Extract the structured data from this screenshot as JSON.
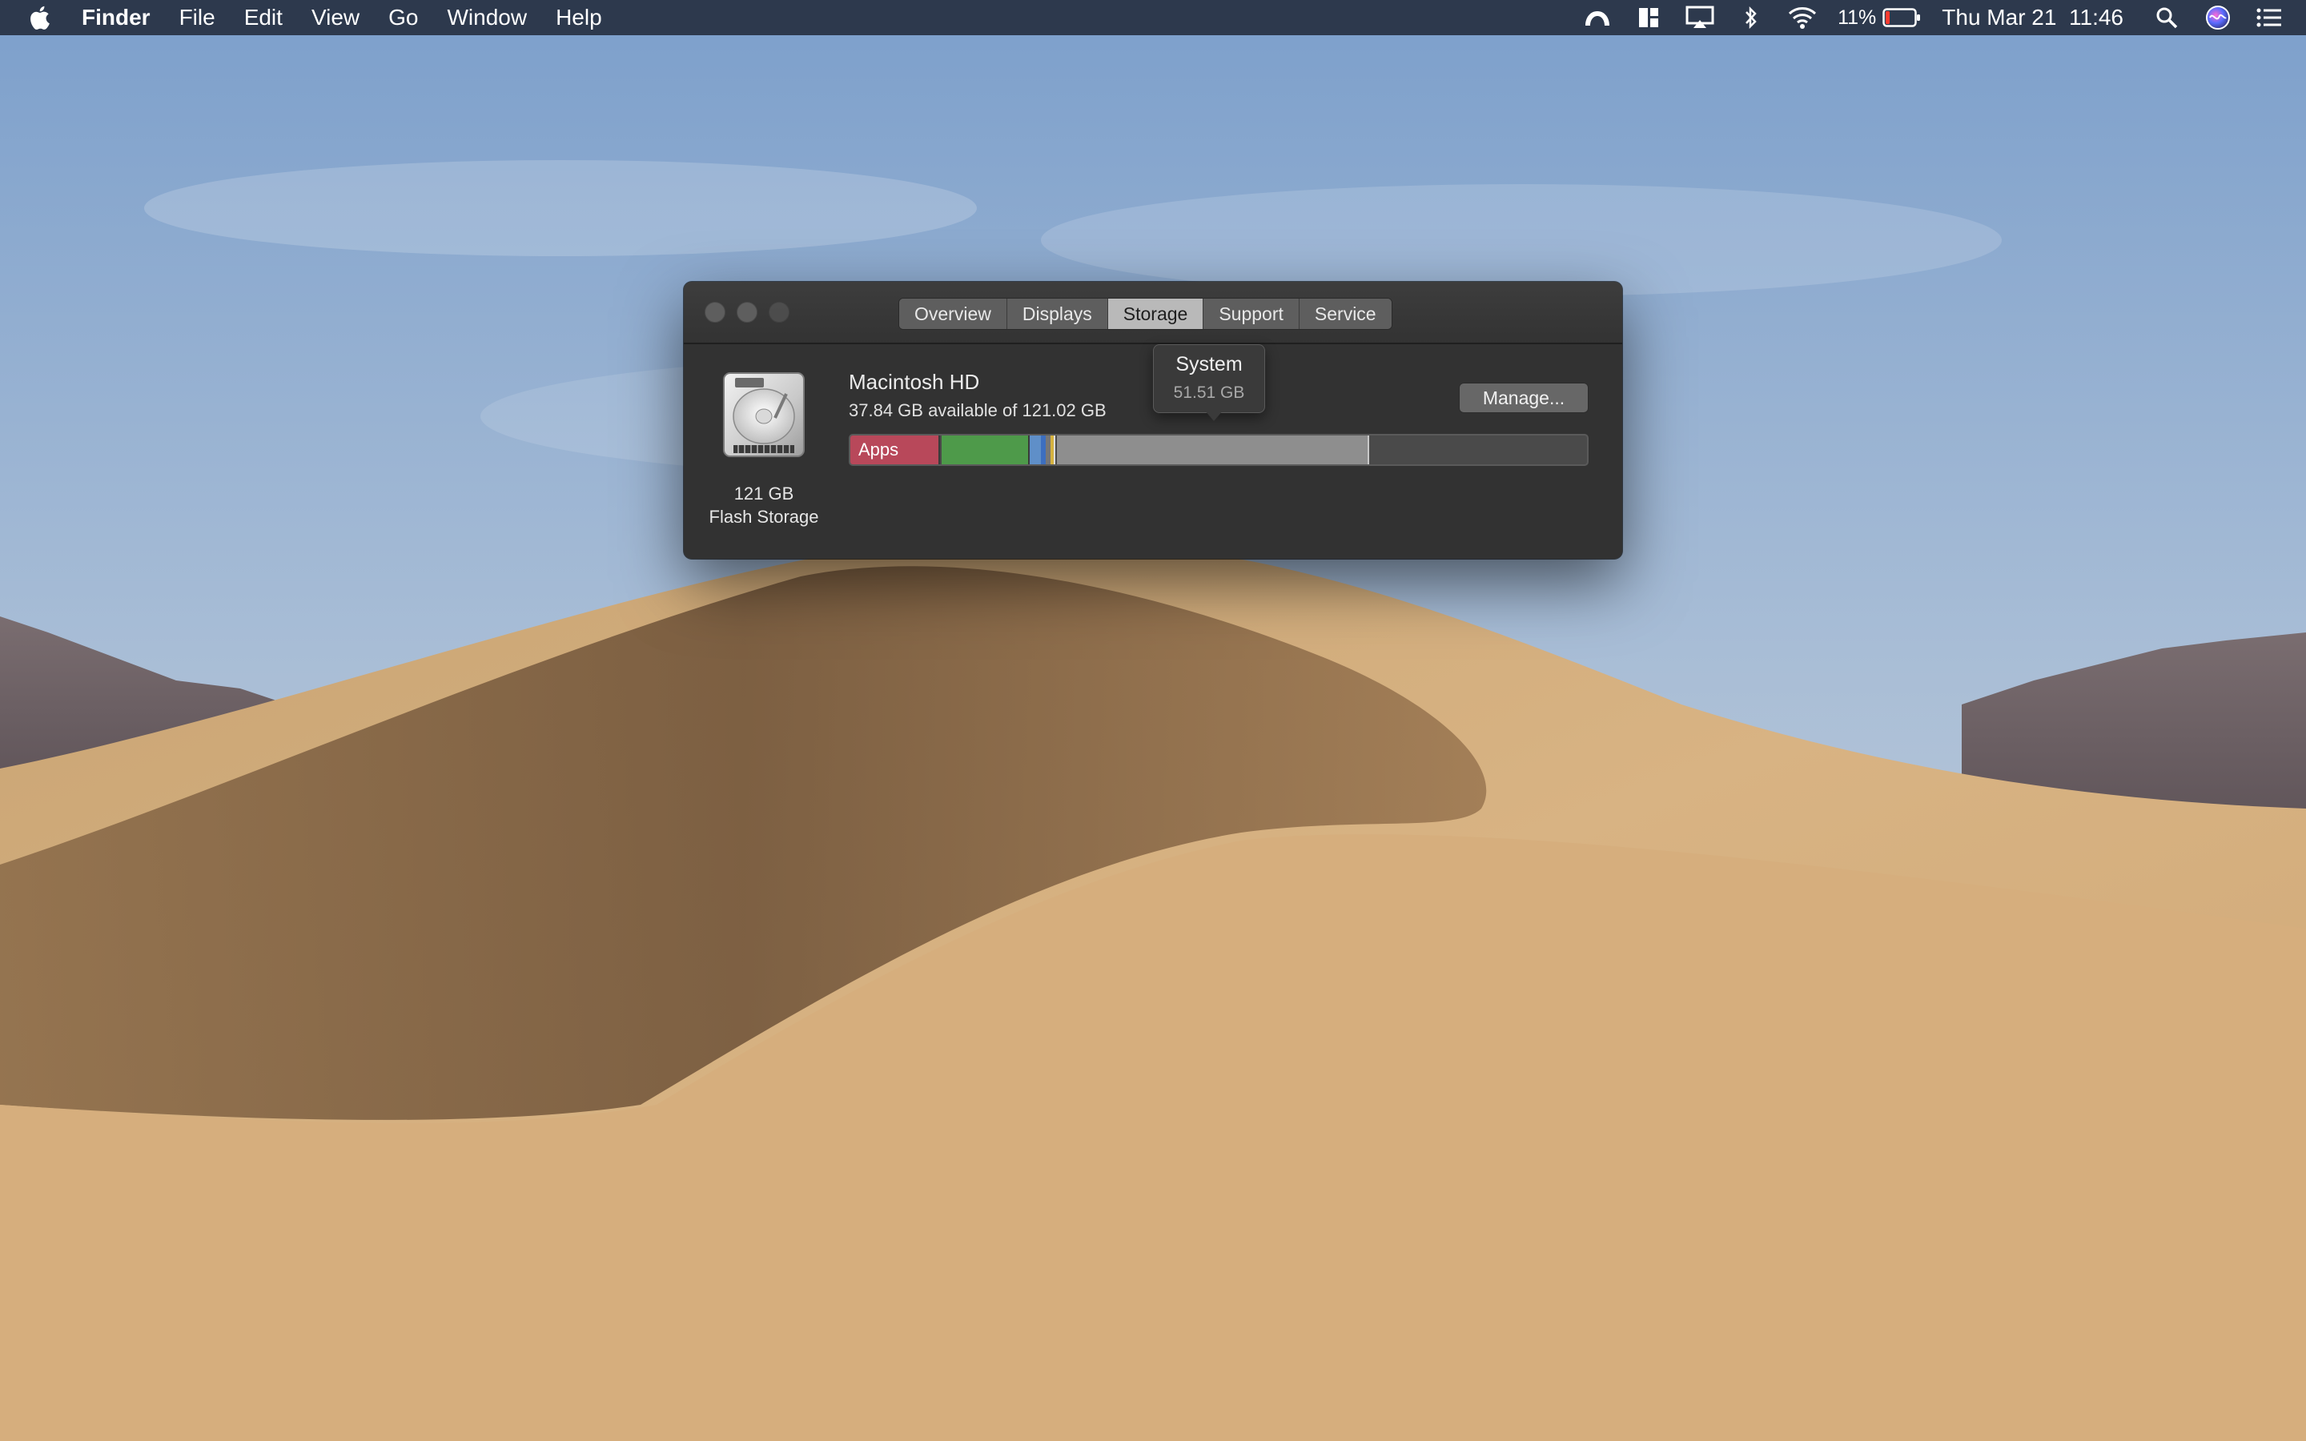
{
  "menubar": {
    "apple_icon": "apple-logo-icon",
    "app_name": "Finder",
    "menus": [
      "File",
      "Edit",
      "View",
      "Go",
      "Window",
      "Help"
    ],
    "status_icons": [
      "creative-cloud-icon",
      "window-tiling-icon",
      "airplay-icon",
      "bluetooth-icon",
      "wifi-icon"
    ],
    "battery_percent_text": "11%",
    "battery_level": 0.11,
    "battery_icon": "battery-icon",
    "clock": "Thu Mar 21  11:46",
    "right_icons": [
      "spotlight-search-icon",
      "siri-icon",
      "notification-center-icon"
    ]
  },
  "window": {
    "tabs": [
      {
        "label": "Overview",
        "active": false
      },
      {
        "label": "Displays",
        "active": false
      },
      {
        "label": "Storage",
        "active": true
      },
      {
        "label": "Support",
        "active": false
      },
      {
        "label": "Service",
        "active": false
      }
    ],
    "disk": {
      "icon": "hard-drive-icon",
      "capacity": "121 GB",
      "type": "Flash Storage"
    },
    "volume": {
      "name": "Macintosh HD",
      "available_text": "37.84 GB available of 121.02 GB"
    },
    "storage_bar": {
      "apps_label": "Apps",
      "colors": {
        "apps": "#b8485a",
        "documents": "#4e9a4a",
        "blue": "#5f8fc8",
        "yellow": "#d6b340",
        "system": "#8e8e8e",
        "free": "#4a4a4a"
      }
    },
    "tooltip": {
      "title": "System",
      "size": "51.51 GB"
    },
    "manage_button": "Manage..."
  }
}
